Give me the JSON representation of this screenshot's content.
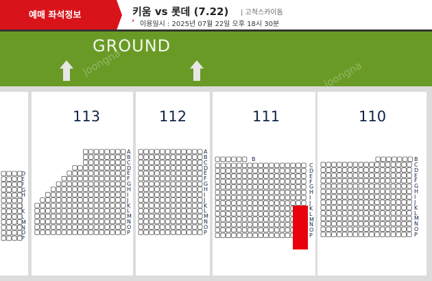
{
  "header": {
    "tab_label": "예매 좌석정보",
    "game_title": "키움 vs 롯데 (7.22)",
    "stadium": "| 고척스카이돔",
    "chevron": "›",
    "date_text": "이용일시 : 2025년 07월 22일 오후 18시 30분"
  },
  "ground": {
    "label": "GROUND"
  },
  "sections": [
    {
      "id": "114",
      "rows": [
        "D",
        "E",
        "F",
        "G",
        "H",
        "I",
        "J",
        "K",
        "L",
        "M",
        "N",
        "O",
        "P"
      ]
    },
    {
      "id": "113",
      "title": "113",
      "rows": [
        "A",
        "B",
        "C",
        "D",
        "E",
        "F",
        "G",
        "H",
        "I",
        "J",
        "K",
        "L",
        "M",
        "N",
        "O",
        "P"
      ]
    },
    {
      "id": "112",
      "title": "112",
      "rows": [
        "A",
        "B",
        "C",
        "D",
        "E",
        "F",
        "G",
        "H",
        "I",
        "J",
        "K",
        "L",
        "M",
        "N",
        "O",
        "P"
      ]
    },
    {
      "id": "111",
      "title": "111",
      "top_row": "B",
      "rows": [
        "C",
        "D",
        "E",
        "F",
        "G",
        "H",
        "I",
        "J",
        "K",
        "L",
        "M",
        "N",
        "O",
        "P"
      ]
    },
    {
      "id": "110",
      "title": "110",
      "rows": [
        "B",
        "C",
        "D",
        "E",
        "F",
        "G",
        "H",
        "I",
        "J",
        "K",
        "L",
        "M",
        "N",
        "O",
        "P"
      ]
    }
  ],
  "selection": {
    "section": "111",
    "color": "#e8000c"
  },
  "colors": {
    "accent": "#d8141a",
    "ground": "#6a9a26",
    "section_text": "#0d2347"
  },
  "watermark": "joongna"
}
